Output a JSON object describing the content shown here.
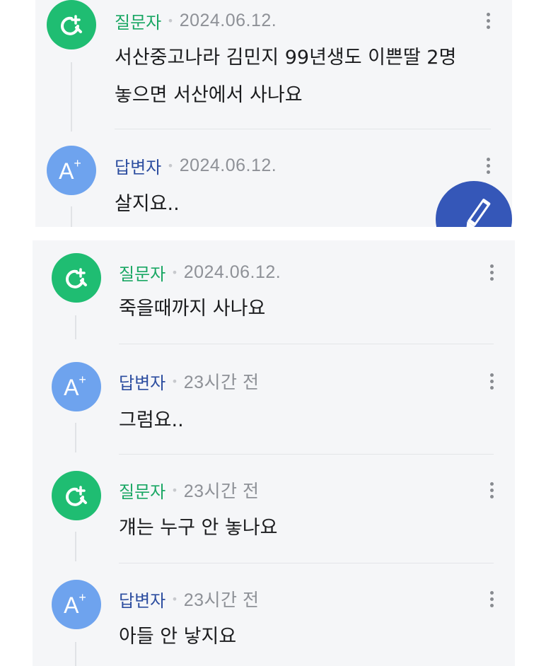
{
  "panel1": {
    "entries": [
      {
        "role": "질문자",
        "date": "2024.06.12.",
        "lines": [
          "서산중고나라 김민지 99년생도 이쁜딸 2명",
          "놓으면 서산에서 사나요"
        ]
      },
      {
        "role": "답변자",
        "date": "2024.06.12.",
        "lines": [
          "살지요.."
        ]
      }
    ],
    "fab_icon": "pencil-icon"
  },
  "panel2": {
    "entries": [
      {
        "role": "질문자",
        "date": "2024.06.12.",
        "lines": [
          "죽을때까지 사나요"
        ]
      },
      {
        "role": "답변자",
        "date": "23시간 전",
        "lines": [
          "그럼요.."
        ]
      },
      {
        "role": "질문자",
        "date": "23시간 전",
        "lines": [
          "걔는 누구 안 놓나요"
        ]
      },
      {
        "role": "답변자",
        "date": "23시간 전",
        "lines": [
          "아들 안 낳지요"
        ]
      }
    ]
  },
  "avatar_labels": {
    "answer": "A",
    "answer_plus": "+"
  },
  "separator": "•",
  "colors": {
    "question": "#1fbd72",
    "answer": "#6ea3ee",
    "fab": "#3557b8",
    "background": "#f5f6f8"
  }
}
